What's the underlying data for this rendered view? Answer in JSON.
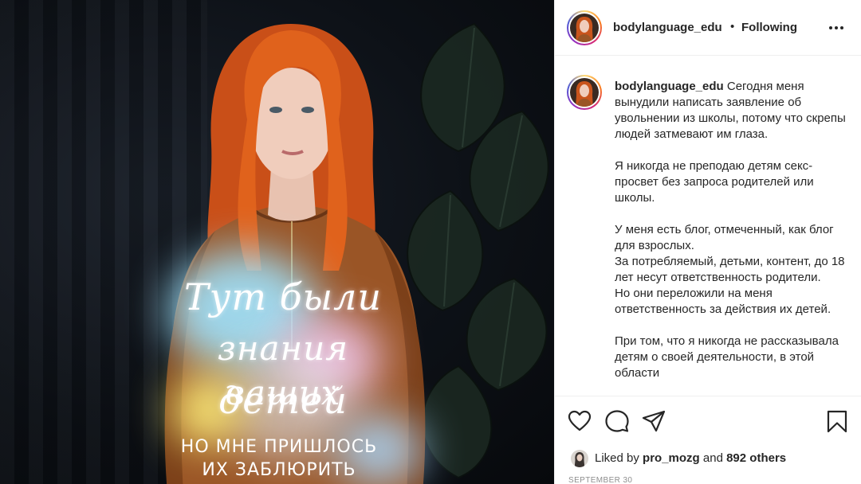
{
  "post_image": {
    "overlay_script_lines": [
      "Тут были",
      "знания ваших",
      "детей"
    ],
    "overlay_caption_lines": [
      "НО МНЕ ПРИШЛОСЬ",
      "ИХ ЗАБЛЮРИТЬ"
    ]
  },
  "header": {
    "username": "bodylanguage_edu",
    "separator": "•",
    "follow_status": "Following",
    "more_icon": "more-horizontal-icon"
  },
  "caption": {
    "username": "bodylanguage_edu",
    "first_text": "Сегодня меня вынудили написать заявление об увольнении из школы, потому что скрепы людей затмевают им глаза.",
    "paragraphs": [
      [
        "Я никогда не преподаю детям секс-просвет без запроса родителей или школы."
      ],
      [
        "У меня есть блог, отмеченный, как блог для взрослых.",
        "За потребляемый, детьми, контент, до 18 лет несут ответственность родители.",
        "Но они переложили на меня ответственность за действия их детей."
      ],
      [
        "При том, что я никогда не рассказывала детям о своей деятельности, в этой области"
      ]
    ]
  },
  "actions": {
    "like_icon": "heart-icon",
    "comment_icon": "comment-icon",
    "share_icon": "paper-plane-icon",
    "save_icon": "bookmark-icon"
  },
  "likes": {
    "prefix": "Liked by",
    "user": "pro_mozg",
    "conjunction": "and",
    "others": "892 others"
  },
  "date": "SEPTEMBER 30",
  "colors": {
    "text": "#262626",
    "secondary": "#8e8e8e",
    "border": "#efefef",
    "hair": "#e0621c"
  }
}
